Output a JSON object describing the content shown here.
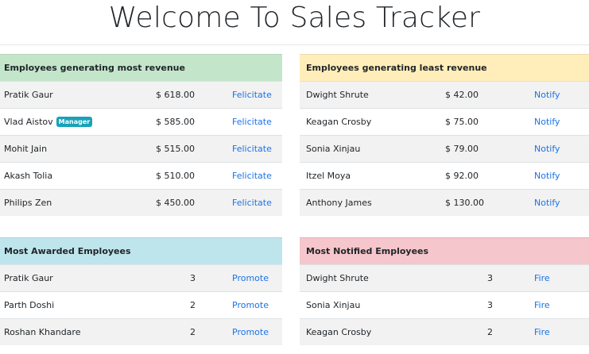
{
  "page": {
    "title": "Welcome To Sales Tracker"
  },
  "colors": {
    "most_revenue_header": "#c3e6cb",
    "least_revenue_header": "#ffeeba",
    "most_awarded_header": "#bee5eb",
    "most_notified_header": "#f5c6cb",
    "link": "#1a73e8",
    "badge": "#17a2b8"
  },
  "most_revenue": {
    "heading": "Employees generating most revenue",
    "rows": [
      {
        "name": "Pratik Gaur",
        "amount": "$ 618.00",
        "action": "Felicitate"
      },
      {
        "name": "Vlad Aistov",
        "badge": "Manager",
        "amount": "$ 585.00",
        "action": "Felicitate"
      },
      {
        "name": "Mohit Jain",
        "amount": "$ 515.00",
        "action": "Felicitate"
      },
      {
        "name": "Akash Tolia",
        "amount": "$ 510.00",
        "action": "Felicitate"
      },
      {
        "name": "Philips Zen",
        "amount": "$ 450.00",
        "action": "Felicitate"
      }
    ]
  },
  "least_revenue": {
    "heading": "Employees generating least revenue",
    "rows": [
      {
        "name": "Dwight Shrute",
        "amount": "$ 42.00",
        "action": "Notify"
      },
      {
        "name": "Keagan Crosby",
        "amount": "$ 75.00",
        "action": "Notify"
      },
      {
        "name": "Sonia Xinjau",
        "amount": "$ 79.00",
        "action": "Notify"
      },
      {
        "name": "Itzel Moya",
        "amount": "$ 92.00",
        "action": "Notify"
      },
      {
        "name": "Anthony James",
        "amount": "$ 130.00",
        "action": "Notify"
      }
    ]
  },
  "most_awarded": {
    "heading": "Most Awarded Employees",
    "rows": [
      {
        "name": "Pratik Gaur",
        "count": "3",
        "action": "Promote"
      },
      {
        "name": "Parth Doshi",
        "count": "2",
        "action": "Promote"
      },
      {
        "name": "Roshan Khandare",
        "count": "2",
        "action": "Promote"
      }
    ]
  },
  "most_notified": {
    "heading": "Most Notified Employees",
    "rows": [
      {
        "name": "Dwight Shrute",
        "count": "3",
        "action": "Fire"
      },
      {
        "name": "Sonia Xinjau",
        "count": "3",
        "action": "Fire"
      },
      {
        "name": "Keagan Crosby",
        "count": "2",
        "action": "Fire"
      }
    ]
  }
}
